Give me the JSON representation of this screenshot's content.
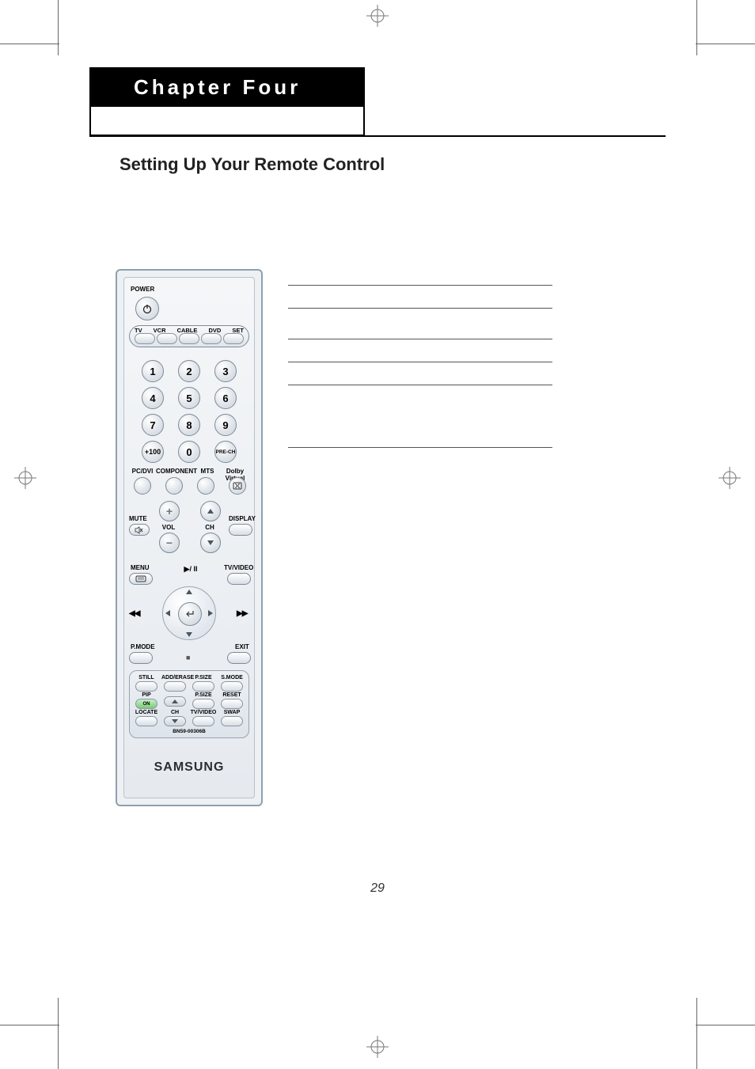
{
  "chapter_title": "Chapter Four",
  "section_title": "Setting Up Your Remote Control",
  "page_number": "29",
  "remote": {
    "power_label": "POWER",
    "mode_labels": [
      "TV",
      "VCR",
      "CABLE",
      "DVD",
      "SET"
    ],
    "numpad": [
      "1",
      "2",
      "3",
      "4",
      "5",
      "6",
      "7",
      "8",
      "9",
      "+100",
      "0",
      "PRE-CH"
    ],
    "row_source_labels": [
      "PC/DVI",
      "COMPONENT",
      "MTS",
      "Dolby Virtual"
    ],
    "mute_label": "MUTE",
    "vol_label": "VOL",
    "ch_label": "CH",
    "display_label": "DISPLAY",
    "menu_label": "MENU",
    "playpause_label": "▶/ II",
    "tvvideo_label": "TV/VIDEO",
    "pmode_label": "P.MODE",
    "exit_label": "EXIT",
    "rew_glyph": "◀◀",
    "ff_glyph": "▶▶",
    "stop_glyph": "■",
    "bottom_rows": {
      "row1": [
        "STILL",
        "ADD/ERASE",
        "P.SIZE",
        "S.MODE"
      ],
      "row2": [
        "PIP",
        "",
        "P.SIZE",
        "RESET"
      ],
      "row2_btn": [
        "ON",
        "▲",
        "",
        ""
      ],
      "row3": [
        "LOCATE",
        "CH",
        "TV/VIDEO",
        "SWAP"
      ],
      "row3_btn": [
        "",
        "▼",
        "",
        ""
      ]
    },
    "model": "BN59-00306B",
    "brand": "SAMSUNG"
  }
}
